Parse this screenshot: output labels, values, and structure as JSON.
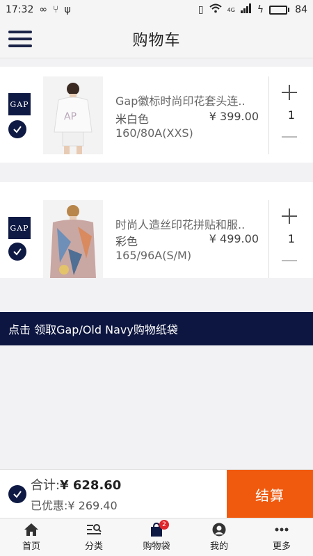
{
  "status_bar": {
    "time": "17:32",
    "network": "4G",
    "battery": "84",
    "battery_level": 0.84
  },
  "header": {
    "title": "购物车"
  },
  "cart": {
    "items": [
      {
        "brand": "GAP",
        "name": "Gap徽标时尚印花套头连..",
        "color": "米白色",
        "price": "¥ 399.00",
        "size": "160/80A(XXS)",
        "quantity": "1",
        "selected": true
      },
      {
        "brand": "GAP",
        "name": "时尚人造丝印花拼贴和服..",
        "color": "彩色",
        "price": "¥ 499.00",
        "size": "165/96A(S/M)",
        "quantity": "1",
        "selected": true
      }
    ]
  },
  "banner": {
    "text": "点击 领取Gap/Old Navy购物纸袋"
  },
  "checkout": {
    "total_label": "合计:",
    "total_value": "¥ 628.60",
    "discount_label": "已优惠:",
    "discount_value": "¥ 269.40",
    "pay_label": "结算"
  },
  "tabbar": {
    "items": [
      {
        "label": "首页",
        "icon": "home-icon"
      },
      {
        "label": "分类",
        "icon": "category-search-icon"
      },
      {
        "label": "购物袋",
        "icon": "shopping-bag-icon",
        "badge": "2"
      },
      {
        "label": "我的",
        "icon": "user-icon"
      },
      {
        "label": "更多",
        "icon": "more-icon"
      }
    ]
  },
  "colors": {
    "navy": "#0f1a44",
    "orange": "#f05a0e",
    "badge_red": "#e0262a"
  }
}
